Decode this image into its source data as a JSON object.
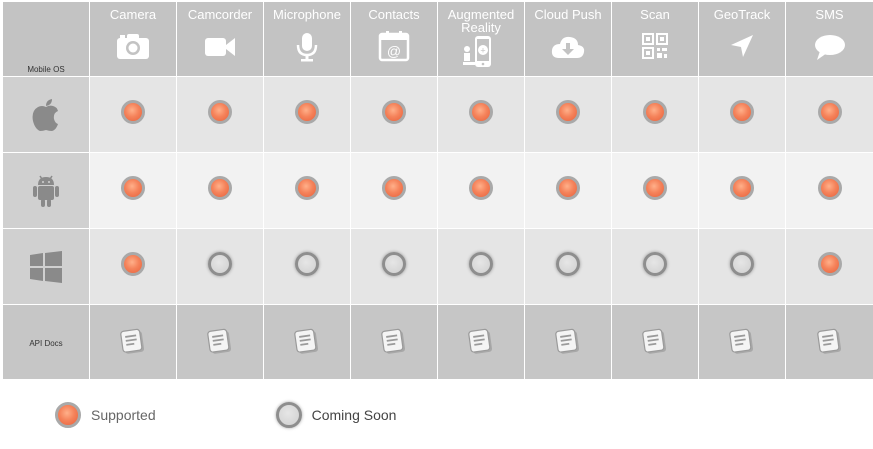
{
  "header": {
    "mobile_os_label": "Mobile OS",
    "columns": [
      {
        "title": "Camera",
        "icon": "camera-icon"
      },
      {
        "title": "Camcorder",
        "icon": "video-camera-icon"
      },
      {
        "title": "Microphone",
        "icon": "microphone-icon"
      },
      {
        "title": "Contacts",
        "icon": "contacts-icon"
      },
      {
        "title": "Augmented\nReality",
        "icon": "augmented-reality-icon"
      },
      {
        "title": "Cloud Push",
        "icon": "cloud-download-icon"
      },
      {
        "title": "Scan",
        "icon": "qr-code-icon"
      },
      {
        "title": "GeoTrack",
        "icon": "location-arrow-icon"
      },
      {
        "title": "SMS",
        "icon": "speech-bubble-icon"
      }
    ]
  },
  "rows": [
    {
      "os": "Apple",
      "icon": "apple-icon",
      "support": [
        "supported",
        "supported",
        "supported",
        "supported",
        "supported",
        "supported",
        "supported",
        "supported",
        "supported"
      ]
    },
    {
      "os": "Android",
      "icon": "android-icon",
      "support": [
        "supported",
        "supported",
        "supported",
        "supported",
        "supported",
        "supported",
        "supported",
        "supported",
        "supported"
      ]
    },
    {
      "os": "Windows",
      "icon": "windows-icon",
      "support": [
        "supported",
        "soon",
        "soon",
        "soon",
        "soon",
        "soon",
        "soon",
        "soon",
        "supported"
      ]
    }
  ],
  "api_docs": {
    "label": "API Docs",
    "icon": "document-icon"
  },
  "legend": {
    "supported": "Supported",
    "coming_soon": "Coming Soon"
  },
  "colors": {
    "header_bg": "#c3c3c3",
    "supported": "#f5835b",
    "coming_soon": "#d8d8d8",
    "row_light": "#f2f2f2",
    "row_mid": "#e5e5e5",
    "os_cell": "#d0d0d0"
  }
}
